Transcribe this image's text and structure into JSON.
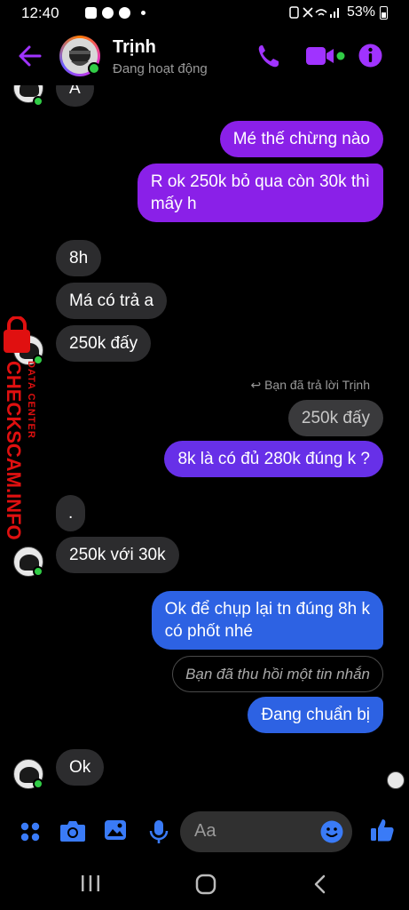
{
  "status_bar": {
    "time": "12:40",
    "battery": "53%"
  },
  "header": {
    "name": "Trịnh",
    "status": "Đang hoạt động"
  },
  "messages": [
    {
      "text": "A"
    },
    {
      "text": "Mé thế chừng nào"
    },
    {
      "line1": "R ok 250k bỏ qua còn 30k thì",
      "line2": "mấy h"
    },
    {
      "text": "8h"
    },
    {
      "text": "Má có trả a"
    },
    {
      "text": "250k đấy"
    },
    {
      "reply_note": "Bạn đã trả lời Trịnh"
    },
    {
      "text": "250k đấy"
    },
    {
      "text": "8k là có đủ 280k đúng k ?"
    },
    {
      "text": "."
    },
    {
      "text": "250k với 30k"
    },
    {
      "line1": "Ok để chụp lại tn đúng 8h k",
      "line2": "có phốt nhé"
    },
    {
      "text": "Bạn đã thu hồi một tin nhắn"
    },
    {
      "text": "Đang chuẩn bị"
    },
    {
      "text": "Ok"
    }
  ],
  "composer": {
    "placeholder": "Aa"
  },
  "watermark": {
    "main": "CHECKSCAM.INFO",
    "sub": "DATA CENTER"
  },
  "colors": {
    "accent": "#a033ff",
    "bubble_in": "#2c2c2e",
    "bubble_purple": "#8a20e8",
    "bubble_indigo": "#6730e8",
    "bubble_blue": "#2d62e3",
    "online": "#31cc46",
    "watermark_red": "#e01010"
  },
  "icons": [
    "back-arrow-icon",
    "phone-icon",
    "video-camera-icon",
    "info-icon",
    "apps-grid-icon",
    "camera-icon",
    "image-icon",
    "microphone-icon",
    "emoji-icon",
    "thumbs-up-icon",
    "reply-arrow-icon",
    "nav-recents-icon",
    "nav-home-icon",
    "nav-back-icon"
  ]
}
